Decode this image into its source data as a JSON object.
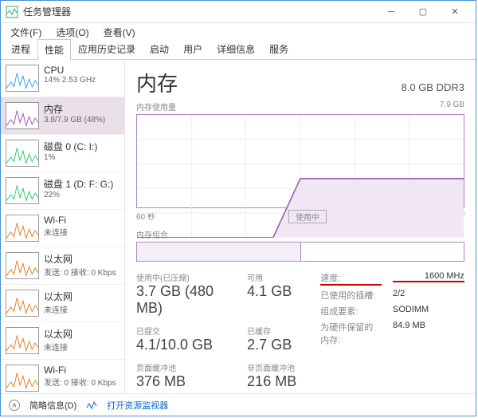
{
  "window": {
    "title": "任务管理器"
  },
  "menu": {
    "file": "文件(F)",
    "options": "选项(O)",
    "view": "查看(V)"
  },
  "tabs": [
    "进程",
    "性能",
    "应用历史记录",
    "启动",
    "用户",
    "详细信息",
    "服务"
  ],
  "active_tab": 1,
  "sidebar": {
    "active": 1,
    "items": [
      {
        "label": "CPU",
        "sub": "14% 2.53 GHz",
        "color": "#3aa0e8"
      },
      {
        "label": "内存",
        "sub": "3.8/7.9 GB (48%)",
        "color": "#9b59b6"
      },
      {
        "label": "磁盘 0 (C: I:)",
        "sub": "1%",
        "color": "#2ecc71"
      },
      {
        "label": "磁盘 1 (D: F: G:)",
        "sub": "22%",
        "color": "#2ecc71"
      },
      {
        "label": "Wi-Fi",
        "sub": "未连接",
        "color": "#e67e22"
      },
      {
        "label": "以太网",
        "sub": "发送: 0 接收: 0 Kbps",
        "color": "#e67e22"
      },
      {
        "label": "以太网",
        "sub": "未连接",
        "color": "#e67e22"
      },
      {
        "label": "以太网",
        "sub": "未连接",
        "color": "#e67e22"
      },
      {
        "label": "Wi-Fi",
        "sub": "发送: 0 接收: 0 Kbps",
        "color": "#e67e22"
      }
    ]
  },
  "main": {
    "title": "内存",
    "capacity": "8.0 GB DDR3",
    "usage_label": "内存使用量",
    "y_max": "7.9 GB",
    "x_left": "60 秒",
    "x_mid": "使用中",
    "x_right": "0",
    "slots_label": "内存组合"
  },
  "chart_data": {
    "type": "area",
    "title": "内存使用量",
    "ylabel": "GB",
    "xlabel": "秒",
    "ylim": [
      0,
      7.9
    ],
    "xlim": [
      60,
      0
    ],
    "x": [
      60,
      55,
      50,
      45,
      40,
      35,
      30,
      25,
      20,
      15,
      10,
      5,
      0
    ],
    "values": [
      0,
      0,
      0,
      0,
      0,
      0,
      3.8,
      3.8,
      3.8,
      3.8,
      3.8,
      3.8,
      3.8
    ]
  },
  "stats_left": [
    {
      "label": "使用中(已压缩)",
      "value": "3.7 GB (480 MB)"
    },
    {
      "label": "可用",
      "value": "4.1 GB"
    },
    {
      "label": "已提交",
      "value": "4.1/10.0 GB"
    },
    {
      "label": "已缓存",
      "value": "2.7 GB"
    },
    {
      "label": "页面缓冲池",
      "value": "376 MB"
    },
    {
      "label": "非页面缓冲池",
      "value": "216 MB"
    }
  ],
  "stats_right": [
    {
      "label": "速度:",
      "value": "1600 MHz",
      "highlight": true
    },
    {
      "label": "已使用的插槽:",
      "value": "2/2"
    },
    {
      "label": "组成要素:",
      "value": "SODIMM"
    },
    {
      "label": "为硬件保留的内存:",
      "value": "84.9 MB"
    }
  ],
  "footer": {
    "brief": "简略信息(D)",
    "resmon": "打开资源监视器"
  }
}
